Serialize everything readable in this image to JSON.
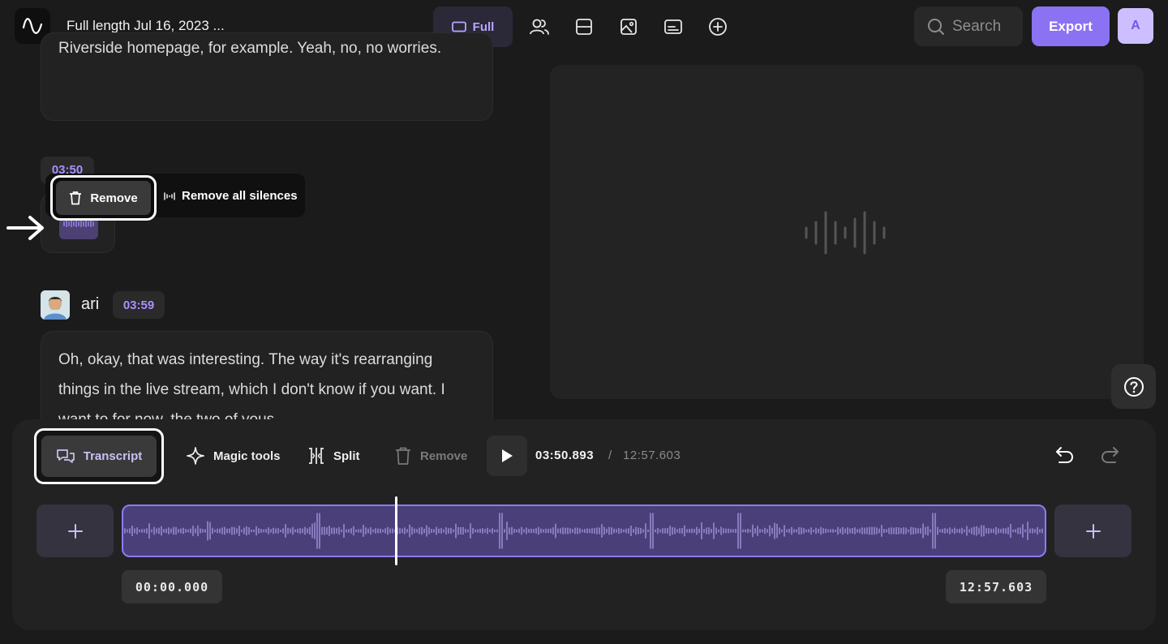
{
  "header": {
    "project_title": "Full length Jul 16, 2023 ...",
    "view_full_label": "Full",
    "search_placeholder": "Search",
    "export_label": "Export",
    "user_initial": "A"
  },
  "transcript": {
    "segment_1_text": "Riverside homepage, for example. Yeah, no, no worries.",
    "silence_time": "03:50",
    "popup": {
      "remove_label": "Remove",
      "remove_all_label": "Remove all silences"
    },
    "speaker_name": "ari",
    "speaker_time": "03:59",
    "segment_2_text": "Oh, okay, that was interesting. The way it's rearranging things in the live stream, which I don't know if you want. I want to for now, the two of yous"
  },
  "toolbar": {
    "transcript_label": "Transcript",
    "magic_tools_label": "Magic tools",
    "split_label": "Split",
    "remove_label": "Remove",
    "current_time": "03:50.893",
    "separator": "/",
    "total_time": "12:57.603"
  },
  "timeline": {
    "start_time": "00:00.000",
    "end_time": "12:57.603"
  },
  "colors": {
    "accent": "#8b72f2",
    "accent_light": "#a98fff",
    "track_fill": "#4b3f7a",
    "background": "#1b1b1b"
  },
  "icons": {
    "logo": "waveform-logo-icon",
    "view_full": "rectangle-icon",
    "view_speakers": "users-icon",
    "view_split": "split-layout-icon",
    "view_image": "image-icon",
    "view_captions": "captions-icon",
    "view_add": "plus-circle-icon",
    "search": "search-icon",
    "help": "question-icon"
  }
}
